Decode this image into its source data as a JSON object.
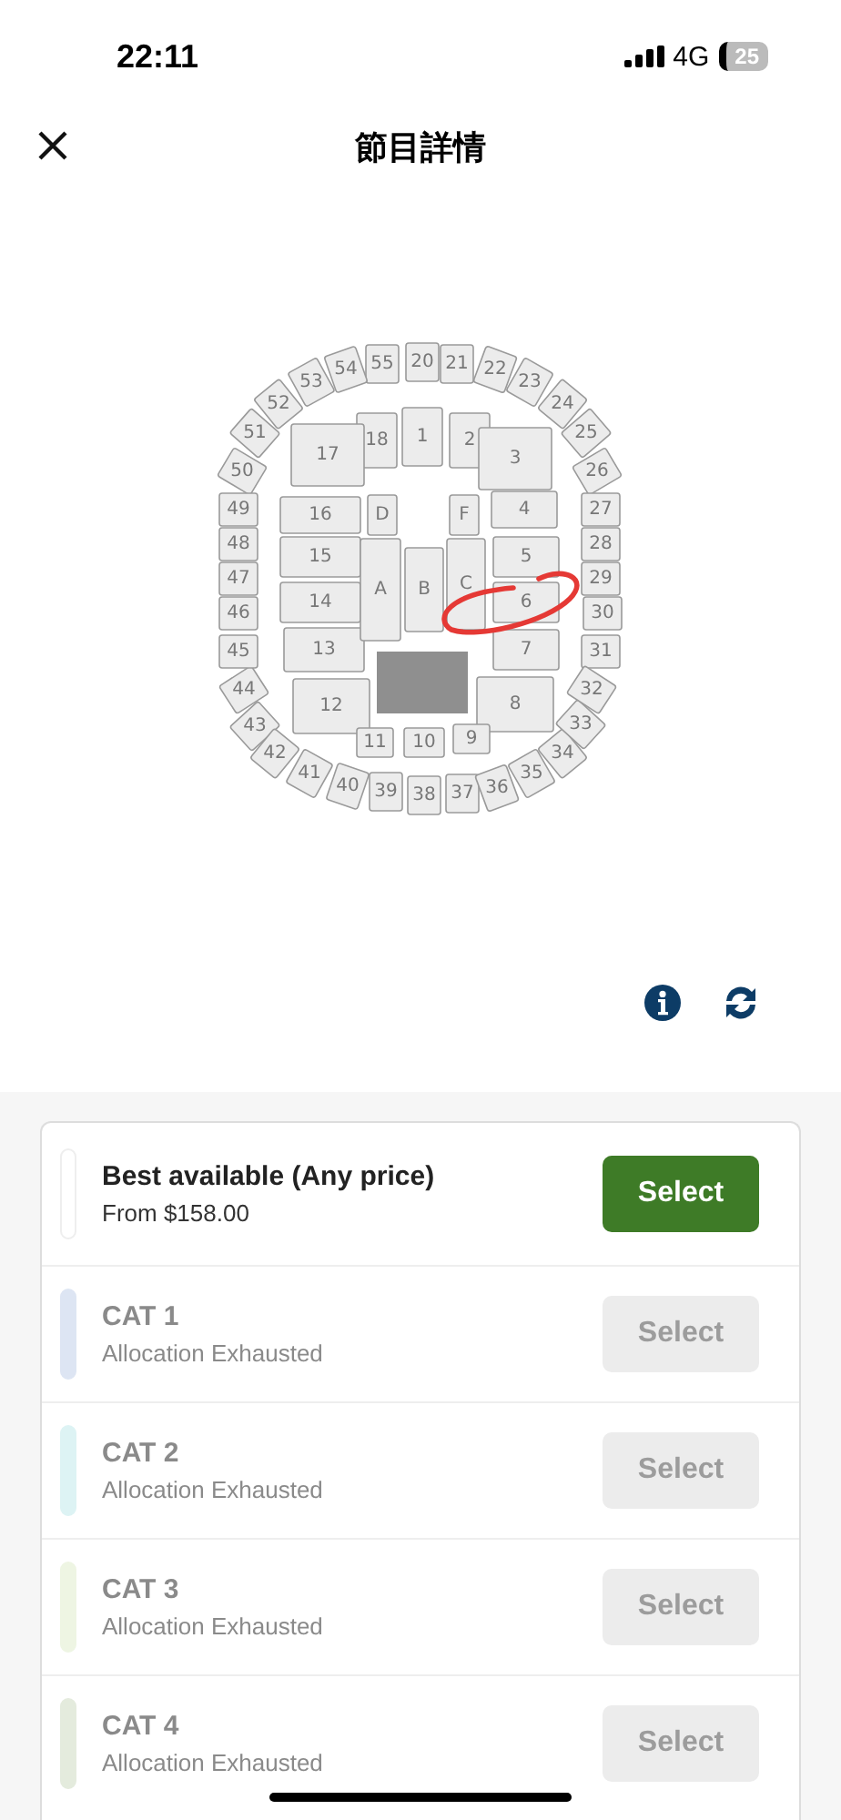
{
  "status_bar": {
    "time": "22:11",
    "network": "4G",
    "battery": "25"
  },
  "header": {
    "title": "節目詳情"
  },
  "seat_map": {
    "sections": [
      {
        "kind": "outer",
        "label": "55"
      },
      {
        "kind": "outer",
        "label": "20"
      },
      {
        "kind": "outer",
        "label": "21"
      },
      {
        "kind": "outer",
        "label": "22"
      },
      {
        "kind": "outer",
        "label": "23"
      },
      {
        "kind": "outer",
        "label": "24"
      },
      {
        "kind": "outer",
        "label": "25"
      },
      {
        "kind": "outer",
        "label": "26"
      },
      {
        "kind": "outer",
        "label": "27"
      },
      {
        "kind": "outer",
        "label": "28"
      },
      {
        "kind": "outer",
        "label": "29"
      },
      {
        "kind": "outer",
        "label": "30"
      },
      {
        "kind": "outer",
        "label": "31"
      },
      {
        "kind": "outer",
        "label": "44"
      },
      {
        "kind": "outer",
        "label": "43"
      },
      {
        "kind": "outer",
        "label": "42"
      },
      {
        "kind": "outer",
        "label": "41"
      },
      {
        "kind": "outer",
        "label": "40"
      },
      {
        "kind": "outer",
        "label": "39"
      },
      {
        "kind": "outer",
        "label": "38"
      },
      {
        "kind": "outer",
        "label": "37"
      },
      {
        "kind": "outer",
        "label": "36"
      },
      {
        "kind": "outer",
        "label": "35"
      },
      {
        "kind": "outer",
        "label": "34"
      },
      {
        "kind": "outer",
        "label": "33"
      },
      {
        "kind": "outer",
        "label": "32"
      },
      {
        "kind": "outer",
        "label": "54"
      },
      {
        "kind": "outer",
        "label": "53"
      },
      {
        "kind": "outer",
        "label": "52"
      },
      {
        "kind": "outer",
        "label": "51"
      },
      {
        "kind": "outer",
        "label": "50"
      },
      {
        "kind": "outer",
        "label": "49"
      },
      {
        "kind": "outer",
        "label": "48"
      },
      {
        "kind": "outer",
        "label": "47"
      },
      {
        "kind": "outer",
        "label": "46"
      },
      {
        "kind": "outer",
        "label": "45"
      },
      {
        "kind": "inner",
        "label": "18"
      },
      {
        "kind": "inner",
        "label": "1"
      },
      {
        "kind": "inner",
        "label": "2"
      },
      {
        "kind": "inner",
        "label": "17"
      },
      {
        "kind": "inner",
        "label": "3"
      },
      {
        "kind": "inner",
        "label": "16"
      },
      {
        "kind": "inner",
        "label": "4"
      },
      {
        "kind": "inner",
        "label": "15"
      },
      {
        "kind": "inner",
        "label": "5"
      },
      {
        "kind": "inner",
        "label": "14"
      },
      {
        "kind": "inner",
        "label": "6"
      },
      {
        "kind": "inner",
        "label": "13"
      },
      {
        "kind": "inner",
        "label": "7"
      },
      {
        "kind": "inner",
        "label": "12"
      },
      {
        "kind": "inner",
        "label": "8"
      },
      {
        "kind": "inner",
        "label": "11"
      },
      {
        "kind": "inner",
        "label": "10"
      },
      {
        "kind": "inner",
        "label": "9"
      },
      {
        "kind": "floor",
        "label": "D"
      },
      {
        "kind": "floor",
        "label": "F"
      },
      {
        "kind": "floor",
        "label": "A"
      },
      {
        "kind": "floor",
        "label": "B"
      },
      {
        "kind": "floor",
        "label": "C"
      }
    ]
  },
  "tickets": [
    {
      "name": "Best available (Any price)",
      "detail": "From $158.00",
      "color": "#ffffff",
      "button": "Select",
      "disabled": false
    },
    {
      "name": "CAT 1",
      "detail": "Allocation Exhausted",
      "color": "#dde5f3",
      "button": "Select",
      "disabled": true
    },
    {
      "name": "CAT 2",
      "detail": "Allocation Exhausted",
      "color": "#ddf3f4",
      "button": "Select",
      "disabled": true
    },
    {
      "name": "CAT 3",
      "detail": "Allocation Exhausted",
      "color": "#eef5e3",
      "button": "Select",
      "disabled": true
    },
    {
      "name": "CAT 4",
      "detail": "Allocation Exhausted",
      "color": "#e4ebdd",
      "button": "Select",
      "disabled": true
    }
  ]
}
